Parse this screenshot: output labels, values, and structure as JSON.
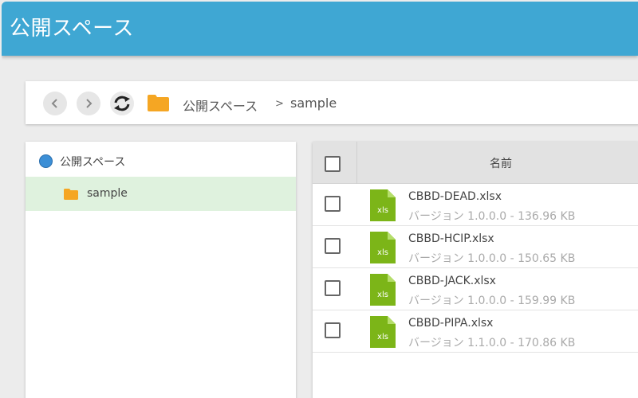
{
  "header": {
    "title": "公開スペース"
  },
  "toolbar": {
    "back_icon": "chevron-left-icon",
    "forward_icon": "chevron-right-icon",
    "refresh_icon": "refresh-icon",
    "folder_icon": "folder-icon",
    "breadcrumb": {
      "root": "公開スペース",
      "separator": ">",
      "current": "sample"
    }
  },
  "tree": {
    "root": {
      "label": "公開スペース",
      "icon": "globe-icon"
    },
    "children": [
      {
        "label": "sample",
        "icon": "folder-icon",
        "selected": true
      }
    ]
  },
  "list": {
    "column_name": "名前",
    "files": [
      {
        "name": "CBBD-DEAD.xlsx",
        "meta": "バージョン 1.0.0.0 - 136.96 KB",
        "icon_label": "xls"
      },
      {
        "name": "CBBD-HCIP.xlsx",
        "meta": "バージョン 1.0.0.0 - 150.65 KB",
        "icon_label": "xls"
      },
      {
        "name": "CBBD-JACK.xlsx",
        "meta": "バージョン 1.0.0.0 - 159.99 KB",
        "icon_label": "xls"
      },
      {
        "name": "CBBD-PIPA.xlsx",
        "meta": "バージョン 1.1.0.0 - 170.86 KB",
        "icon_label": "xls"
      }
    ]
  },
  "colors": {
    "header": "#3fa7d3",
    "folder": "#f5a623",
    "xls_icon": "#7cb518",
    "selected_row": "#dff2de"
  }
}
